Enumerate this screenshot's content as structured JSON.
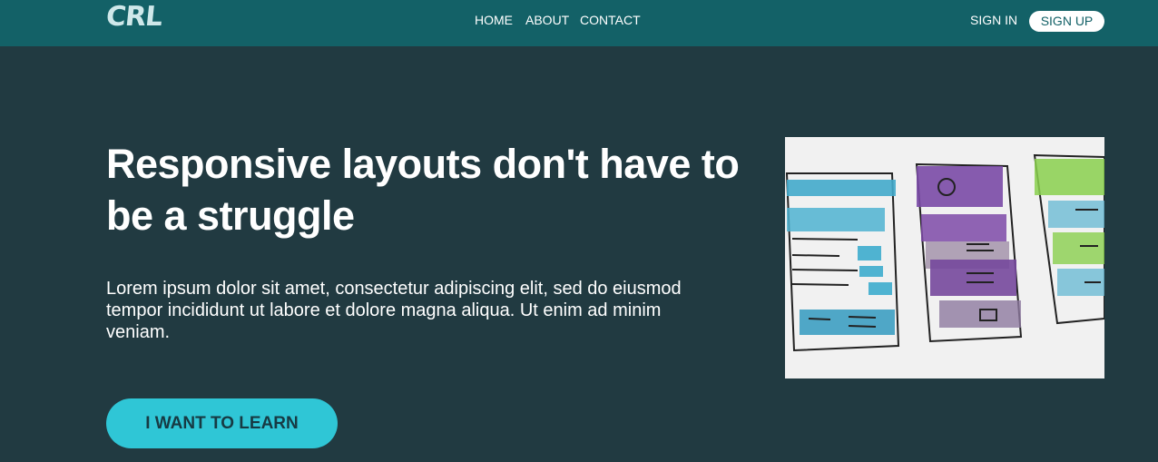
{
  "header": {
    "logo_text": "CRL",
    "nav": {
      "home": "HOME",
      "about": "ABOUT",
      "contact": "CONTACT"
    },
    "sign_in": "SIGN IN",
    "sign_up": "SIGN UP"
  },
  "hero": {
    "title": "Responsive layouts don't have to be a struggle",
    "description": "Lorem ipsum dolor sit amet, consectetur adipiscing elit, sed do eiusmod tempor incididunt ut labore et dolore magna aliqua. Ut enim ad minim veniam.",
    "cta_label": "I WANT TO LEARN"
  },
  "colors": {
    "background": "#213a41",
    "header": "#136167",
    "accent": "#2fc6d6",
    "white": "#ffffff"
  }
}
